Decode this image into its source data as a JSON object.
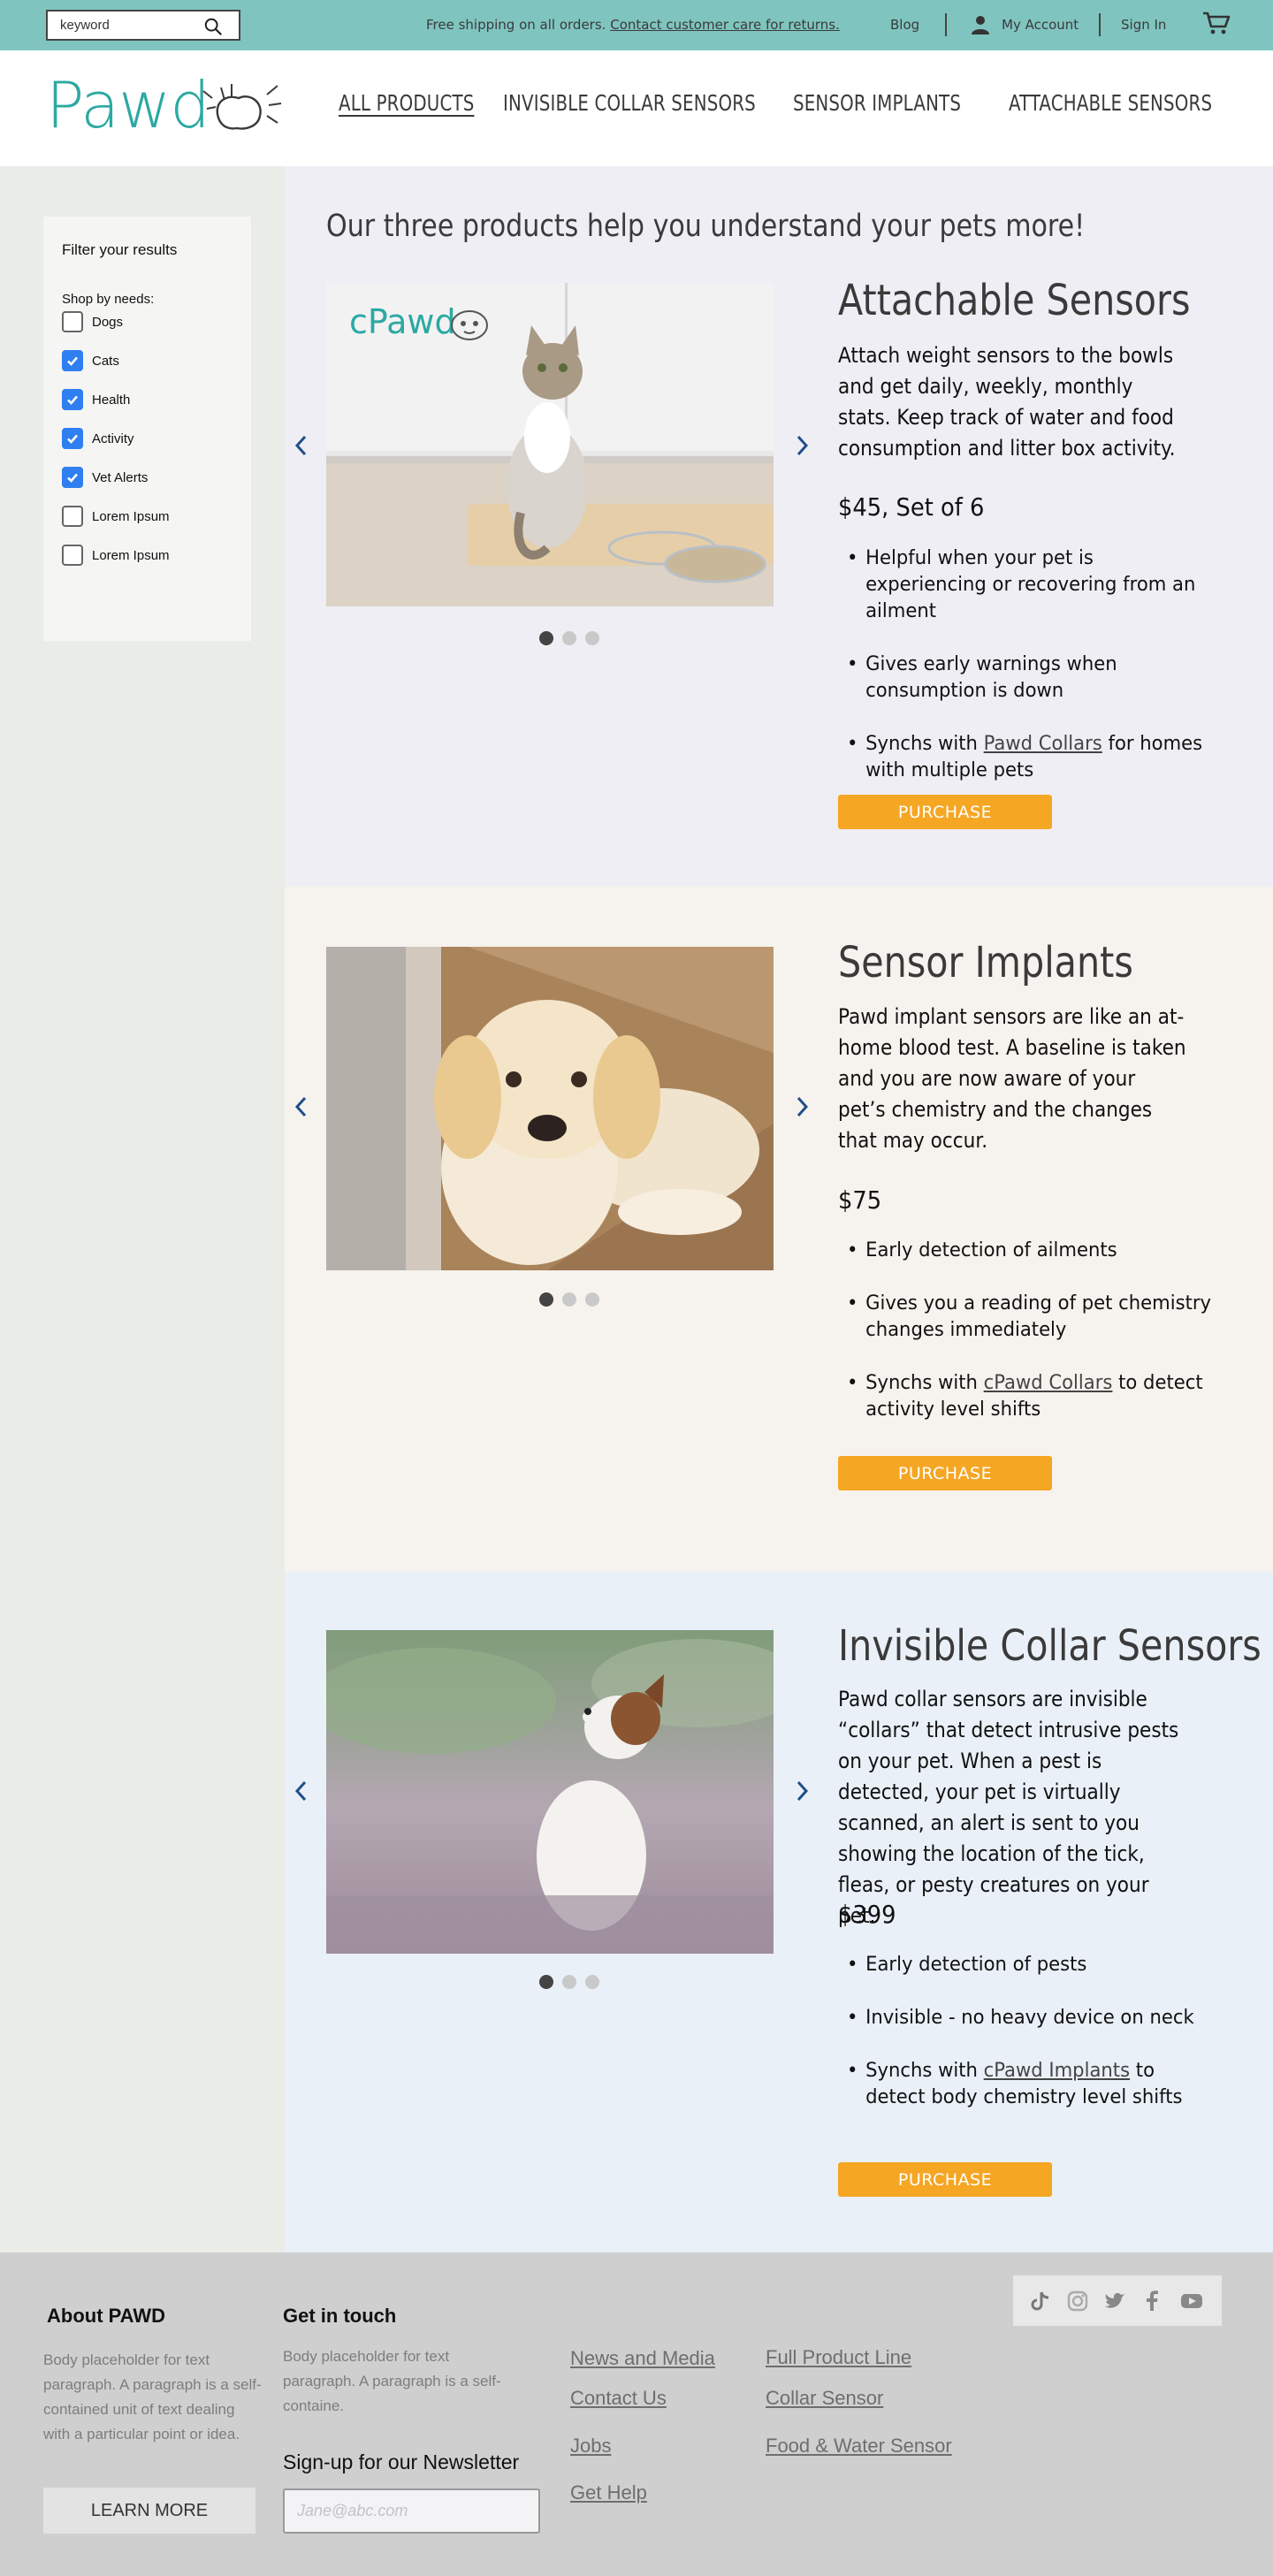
{
  "colors": {
    "topbar": "#7fc4bf",
    "brand": "#2ba9a2",
    "purchase": "#f5a623",
    "checkbox": "#2f7ff0",
    "section1_bg": "#efeef4",
    "section2_bg": "#f6f3ee",
    "section3_bg": "#eaf0f8",
    "sidebar_bg": "#eaece7",
    "footer_bg": "#cfcfcf"
  },
  "topbar": {
    "search_value": "keyword",
    "shipping_text": "Free shipping on all orders.",
    "shipping_link": "Contact customer care for returns.",
    "blog": "Blog",
    "my_account": "My Account",
    "sign_in": "Sign In",
    "icons": [
      "search-icon",
      "account-icon",
      "cart-icon"
    ]
  },
  "header": {
    "logo_text": "Pawd",
    "nav": [
      "ALL PRODUCTS",
      "INVISIBLE COLLAR SENSORS",
      "SENSOR IMPLANTS",
      "ATTACHABLE SENSORS"
    ]
  },
  "filters": {
    "title": "Filter your results",
    "shop_by": "Shop by needs:",
    "items": [
      {
        "label": "Dogs",
        "checked": false
      },
      {
        "label": "Cats",
        "checked": true
      },
      {
        "label": "Health",
        "checked": true
      },
      {
        "label": "Activity",
        "checked": true
      },
      {
        "label": "Vet Alerts",
        "checked": true
      },
      {
        "label": "Lorem Ipsum",
        "checked": false
      },
      {
        "label": "Lorem Ipsum",
        "checked": false
      }
    ]
  },
  "main": {
    "headline": "Our three products help you understand your pets more!",
    "products": [
      {
        "title": "Attachable Sensors",
        "description": "Attach weight sensors to the bowls and get daily, weekly, monthly stats. Keep track of water and food consumption and litter box activity.",
        "price": "$45, Set of 6",
        "photo_logo": "cPawd",
        "bullets": [
          {
            "text": "Helpful when your pet is experiencing or recovering from an ailment"
          },
          {
            "text": "Gives early warnings when consumption is down"
          },
          {
            "before": "Synchs with ",
            "link": "Pawd Collars",
            "after": " for homes with multiple pets"
          }
        ],
        "button": "PURCHASE"
      },
      {
        "title": "Sensor Implants",
        "description": "Pawd implant sensors are like an at-home blood test. A baseline is taken and you are now aware of your pet’s chemistry and the changes that may occur.",
        "price": "$75",
        "bullets": [
          {
            "text": "Early detection of ailments"
          },
          {
            "text": "Gives you a reading of pet chemistry changes immediately"
          },
          {
            "before": "Synchs with ",
            "link": "cPawd Collars",
            "after": " to detect activity level shifts"
          }
        ],
        "button": "PURCHASE"
      },
      {
        "title": "Invisible Collar Sensors",
        "description": "Pawd collar sensors are invisible “collars” that detect intrusive pests on your pet. When a pest is detected, your pet is virtually scanned, an alert is sent to you showing the location of the tick, fleas, or pesty creatures on your pet.",
        "price": "$399",
        "bullets": [
          {
            "text": "Early detection of pests"
          },
          {
            "text": "Invisible - no heavy device on neck"
          },
          {
            "before": "Synchs with ",
            "link": "cPawd Implants",
            "after": " to detect body chemistry level shifts"
          }
        ],
        "button": "PURCHASE"
      }
    ]
  },
  "footer": {
    "about_title": "About PAWD",
    "about_body": "Body placeholder for text paragraph. A paragraph is a self-contained unit of text dealing with a particular point or idea.",
    "learn_more": "LEARN MORE",
    "contact_title": "Get in touch",
    "contact_body": "Body placeholder for text paragraph. A paragraph is a self-containe.",
    "newsletter": "Sign-up for our Newsletter",
    "email_placeholder": "Jane@abc.com",
    "links_col1": [
      "News and Media",
      "Contact Us",
      "Jobs",
      "Get Help"
    ],
    "links_col2": [
      "Full Product Line",
      "Collar Sensor",
      "Food & Water Sensor"
    ],
    "social_icons": [
      "tiktok-icon",
      "instagram-icon",
      "twitter-icon",
      "facebook-icon",
      "youtube-icon"
    ]
  }
}
